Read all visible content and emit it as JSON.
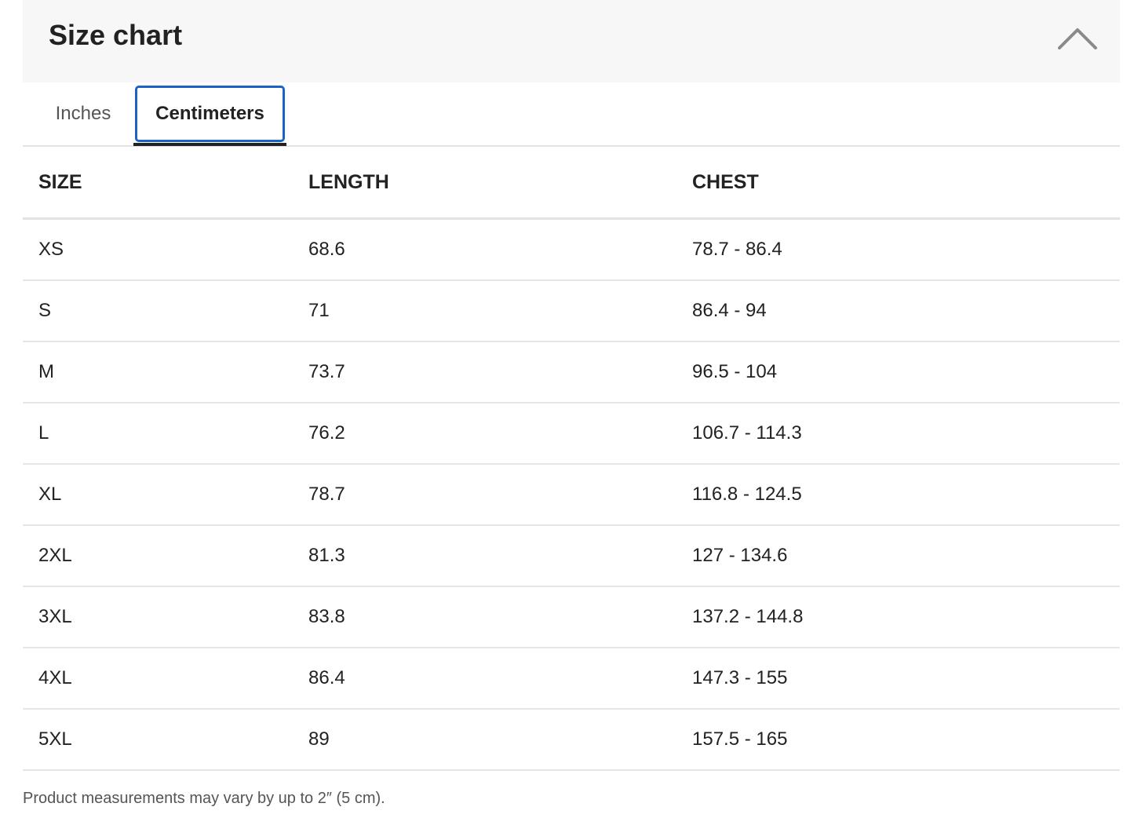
{
  "header": {
    "title": "Size chart",
    "collapse_icon": "chevron-up-icon"
  },
  "tabs": [
    {
      "label": "Inches",
      "active": false
    },
    {
      "label": "Centimeters",
      "active": true
    }
  ],
  "colors": {
    "active_tab_border": "#1a63c4",
    "header_bg": "#f7f7f7"
  },
  "table": {
    "columns": [
      "SIZE",
      "LENGTH",
      "CHEST"
    ],
    "rows": [
      [
        "XS",
        "68.6",
        "78.7 - 86.4"
      ],
      [
        "S",
        "71",
        "86.4 - 94"
      ],
      [
        "M",
        "73.7",
        "96.5 - 104"
      ],
      [
        "L",
        "76.2",
        "106.7 - 114.3"
      ],
      [
        "XL",
        "78.7",
        "116.8 - 124.5"
      ],
      [
        "2XL",
        "81.3",
        "127 - 134.6"
      ],
      [
        "3XL",
        "83.8",
        "137.2 - 144.8"
      ],
      [
        "4XL",
        "86.4",
        "147.3 - 155"
      ],
      [
        "5XL",
        "89",
        "157.5 - 165"
      ]
    ]
  },
  "footer": {
    "note": "Product measurements may vary by up to 2″ (5 cm)."
  }
}
